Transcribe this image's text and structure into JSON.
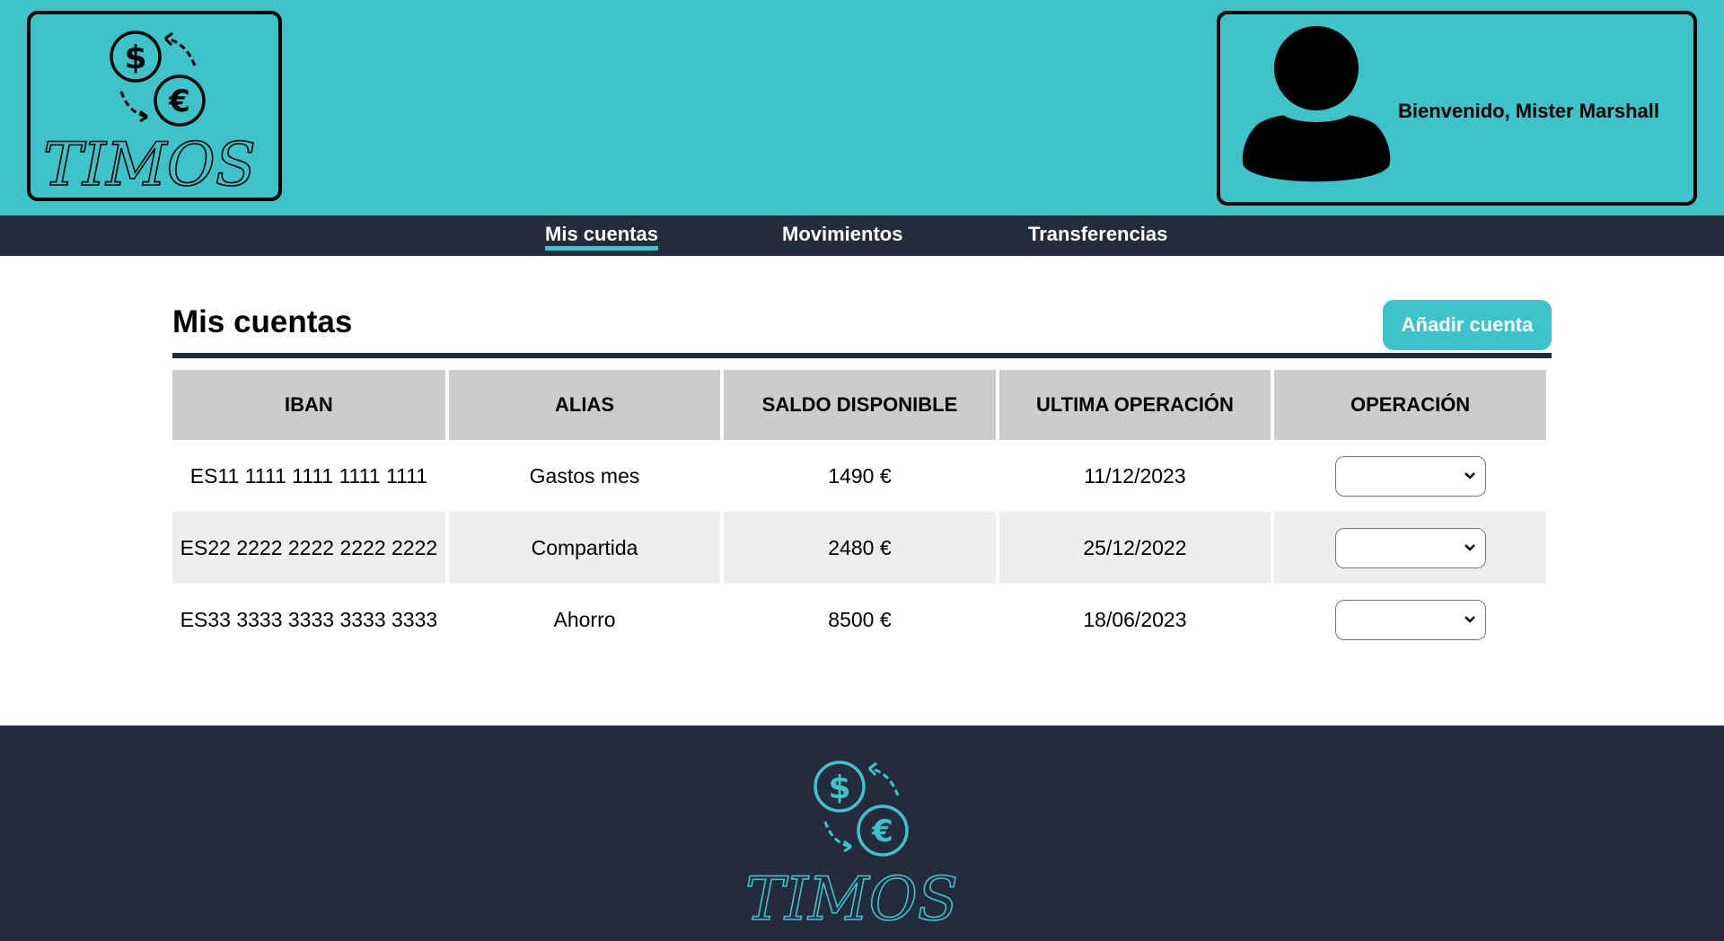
{
  "brand": {
    "name": "TIMOS",
    "accent_color": "#3ec3cb",
    "dark_color": "#242b3d"
  },
  "header": {
    "welcome_text": "Bienvenido, Mister Marshall",
    "avatar_icon": "user-silhouette-icon"
  },
  "nav": {
    "items": [
      {
        "label": "Mis cuentas",
        "active": true
      },
      {
        "label": "Movimientos",
        "active": false
      },
      {
        "label": "Transferencias",
        "active": false
      }
    ]
  },
  "main": {
    "title": "Mis cuentas",
    "add_button_label": "Añadir cuenta",
    "table": {
      "headers": [
        "IBAN",
        "ALIAS",
        "SALDO DISPONIBLE",
        "ULTIMA OPERACIÓN",
        "OPERACIÓN"
      ],
      "rows": [
        {
          "iban": "ES11 1111 1111 1111 1111",
          "alias": "Gastos mes",
          "saldo": "1490 €",
          "ultima": "11/12/2023",
          "operacion": ""
        },
        {
          "iban": "ES22 2222 2222 2222 2222",
          "alias": "Compartida",
          "saldo": "2480 €",
          "ultima": "25/12/2022",
          "operacion": ""
        },
        {
          "iban": "ES33 3333 3333 3333 3333",
          "alias": "Ahorro",
          "saldo": "8500 €",
          "ultima": "18/06/2023",
          "operacion": ""
        }
      ]
    }
  }
}
